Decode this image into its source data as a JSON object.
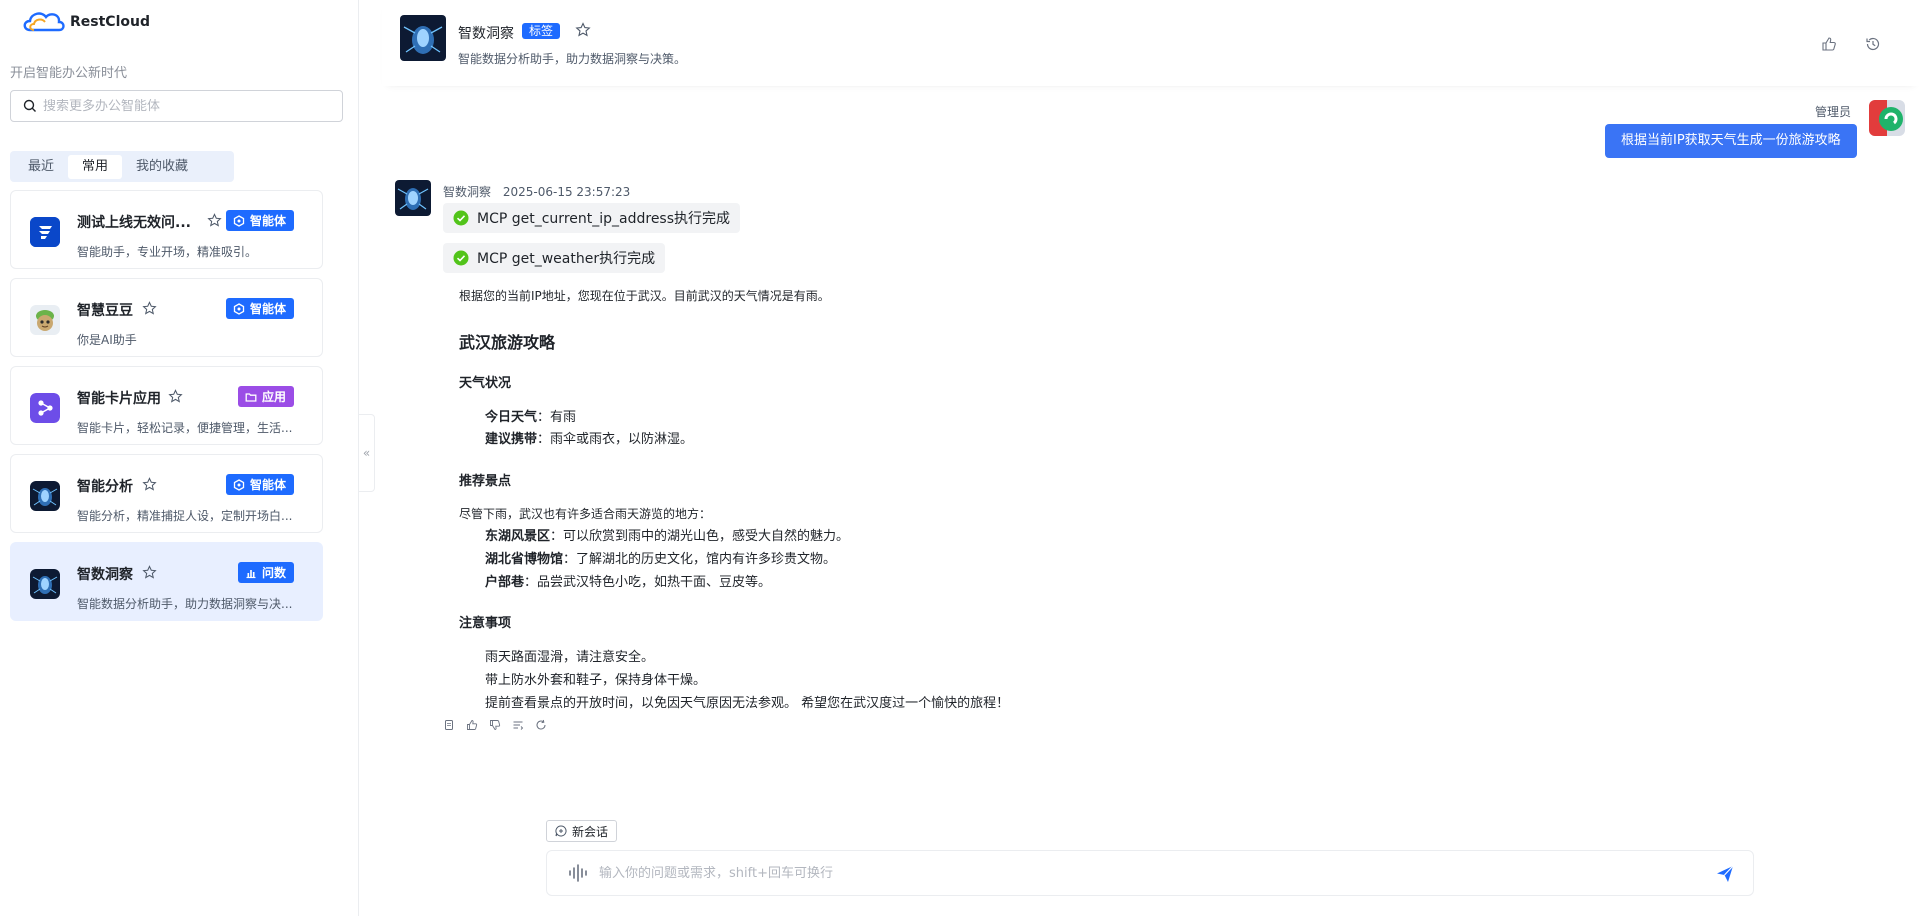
{
  "brand": {
    "name": "RestCloud",
    "slogan": "开启智能办公新时代"
  },
  "search": {
    "placeholder": "搜索更多办公智能体"
  },
  "tabs": [
    {
      "label": "最近",
      "active": false
    },
    {
      "label": "常用",
      "active": true
    },
    {
      "label": "我的收藏",
      "active": false
    }
  ],
  "agents": [
    {
      "name": "测试上线无效问...",
      "desc": "智能助手，专业开场，精准吸引。",
      "badge": "智能体",
      "badge_color": "#1e6bff",
      "icon": "agent-cube-icon"
    },
    {
      "name": "智慧豆豆",
      "desc": "你是AI助手",
      "badge": "智能体",
      "badge_color": "#1e6bff",
      "icon": "agent-cube-icon"
    },
    {
      "name": "智能卡片应用",
      "desc": "智能卡片，轻松记录，便捷管理，生活...",
      "badge": "应用",
      "badge_color": "#9b4de6",
      "icon": "folder-icon"
    },
    {
      "name": "智能分析",
      "desc": "智能分析，精准捕捉人设，定制开场白...",
      "badge": "智能体",
      "badge_color": "#1e6bff",
      "icon": "agent-cube-icon"
    },
    {
      "name": "智数洞察",
      "desc": "智能数据分析助手，助力数据洞察与决...",
      "badge": "问数",
      "badge_color": "#1e6bff",
      "icon": "bar-chart-icon",
      "selected": true
    }
  ],
  "header": {
    "title": "智数洞察",
    "tag": "标签",
    "desc": "智能数据分析助手，助力数据洞察与决策。"
  },
  "user_msg": {
    "role": "管理员",
    "text": "根据当前IP获取天气生成一份旅游攻略"
  },
  "bot_msg": {
    "name": "智数洞察",
    "time": "2025-06-15 23:57:23",
    "tools": [
      "MCP get_current_ip_address执行完成",
      "MCP get_weather执行完成"
    ],
    "intro": "根据您的当前IP地址，您现在位于武汉。目前武汉的天气情况是有雨。",
    "title": "武汉旅游攻略",
    "weather": {
      "heading": "天气状况",
      "items": [
        {
          "label": "今日天气",
          "text": "：有雨"
        },
        {
          "label": "建议携带",
          "text": "：雨伞或雨衣，以防淋湿。"
        }
      ]
    },
    "spots": {
      "heading": "推荐景点",
      "intro": "尽管下雨，武汉也有许多适合雨天游览的地方：",
      "items": [
        {
          "label": "东湖风景区",
          "text": "：可以欣赏到雨中的湖光山色，感受大自然的魅力。"
        },
        {
          "label": "湖北省博物馆",
          "text": "：了解湖北的历史文化，馆内有许多珍贵文物。"
        },
        {
          "label": "户部巷",
          "text": "：品尝武汉特色小吃，如热干面、豆皮等。"
        }
      ]
    },
    "notes": {
      "heading": "注意事项",
      "items": [
        "雨天路面湿滑，请注意安全。",
        "带上防水外套和鞋子，保持身体干燥。",
        "提前查看景点的开放时间，以免因天气原因无法参观。 希望您在武汉度过一个愉快的旅程！"
      ]
    }
  },
  "composer": {
    "new_session": "新会话",
    "placeholder": "输入你的问题或需求，shift+回车可换行"
  },
  "colors": {
    "accent": "#1e6bff",
    "app_badge": "#9b4de6",
    "user_bubble": "#3a74f5",
    "success": "#52c41a"
  }
}
